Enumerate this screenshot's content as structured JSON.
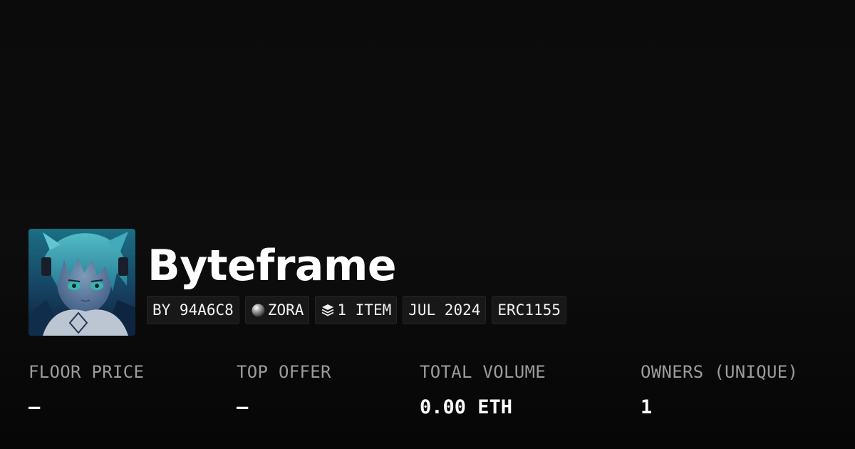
{
  "collection": {
    "title": "Byteframe",
    "tags": {
      "creator": "BY 94A6C8",
      "network": "ZORA",
      "items": "1 ITEM",
      "date": "JUL 2024",
      "standard": "ERC1155"
    },
    "icons": {
      "network": "zora-orb-icon",
      "items": "layers-icon"
    }
  },
  "stats": [
    {
      "label": "FLOOR PRICE",
      "value": "–"
    },
    {
      "label": "TOP OFFER",
      "value": "–"
    },
    {
      "label": "TOTAL VOLUME",
      "value": "0.00 ETH"
    },
    {
      "label": "OWNERS (UNIQUE)",
      "value": "1"
    }
  ],
  "colors": {
    "background": "#0b0b0b",
    "tag_background": "#181818",
    "label_gray": "#9c9c9c",
    "text": "#ffffff"
  }
}
